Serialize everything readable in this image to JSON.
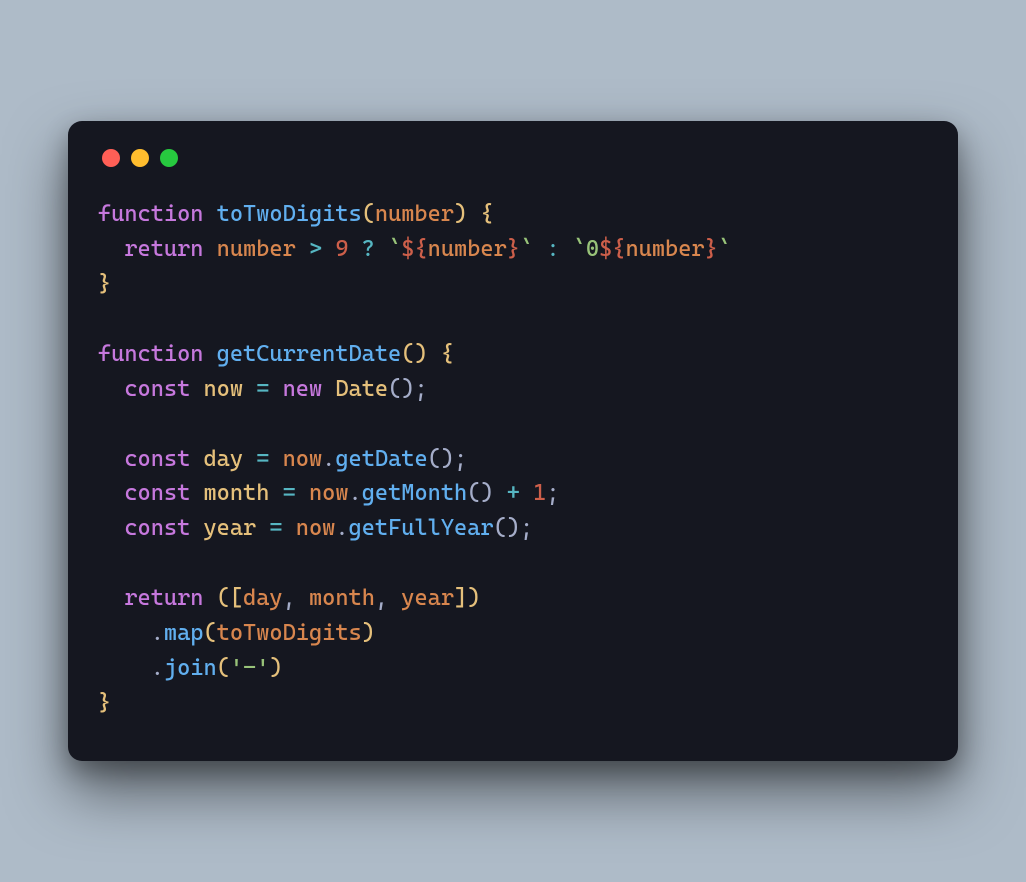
{
  "window": {
    "traffic_lights": {
      "red": "#ff5f56",
      "yellow": "#ffbd2e",
      "green": "#27c93f"
    }
  },
  "code": {
    "line1": {
      "kw_function": "function",
      "fn_name": "toTwoDigits",
      "paren_open": "(",
      "param": "number",
      "paren_close": ")",
      "brace_open": "{"
    },
    "line2": {
      "indent": "  ",
      "kw_return": "return",
      "ident": "number",
      "op_gt": ">",
      "num_9": "9",
      "op_q": "?",
      "tmpl_open1": "`",
      "interp_open1": "${",
      "interp_ident1": "number",
      "interp_close1": "}",
      "tmpl_close1": "`",
      "op_colon": ":",
      "tmpl_open2": "`",
      "str_zero": "0",
      "interp_open2": "${",
      "interp_ident2": "number",
      "interp_close2": "}",
      "tmpl_close2": "`"
    },
    "line3": {
      "brace_close": "}"
    },
    "line5": {
      "kw_function": "function",
      "fn_name": "getCurrentDate",
      "parens": "()",
      "brace_open": "{"
    },
    "line6": {
      "indent": "  ",
      "kw_const": "const",
      "var_now": "now",
      "op_eq": "=",
      "kw_new": "new",
      "cls_date": "Date",
      "parens": "()",
      "semi": ";"
    },
    "line8": {
      "indent": "  ",
      "kw_const": "const",
      "var_day": "day",
      "op_eq": "=",
      "ident_now": "now",
      "dot": ".",
      "method": "getDate",
      "parens": "()",
      "semi": ";"
    },
    "line9": {
      "indent": "  ",
      "kw_const": "const",
      "var_month": "month",
      "op_eq": "=",
      "ident_now": "now",
      "dot": ".",
      "method": "getMonth",
      "parens": "()",
      "op_plus": "+",
      "num_1": "1",
      "semi": ";"
    },
    "line10": {
      "indent": "  ",
      "kw_const": "const",
      "var_year": "year",
      "op_eq": "=",
      "ident_now": "now",
      "dot": ".",
      "method": "getFullYear",
      "parens": "()",
      "semi": ";"
    },
    "line12": {
      "indent": "  ",
      "kw_return": "return",
      "paren_open": "(",
      "bracket_open": "[",
      "id_day": "day",
      "comma1": ",",
      "id_month": "month",
      "comma2": ",",
      "id_year": "year",
      "bracket_close": "]",
      "paren_close": ")"
    },
    "line13": {
      "indent": "    ",
      "dot": ".",
      "method": "map",
      "paren_open": "(",
      "arg": "toTwoDigits",
      "paren_close": ")"
    },
    "line14": {
      "indent": "    ",
      "dot": ".",
      "method": "join",
      "paren_open": "(",
      "str": "'-'",
      "paren_close": ")"
    },
    "line15": {
      "brace_close": "}"
    }
  }
}
